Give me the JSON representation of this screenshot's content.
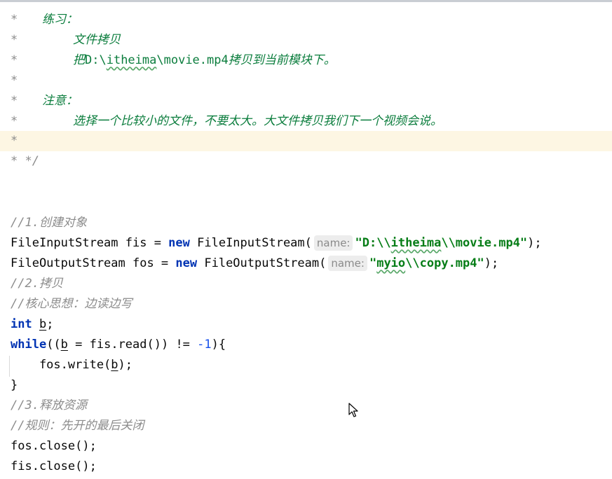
{
  "code": {
    "c1_star": "*",
    "c1_text": "练习：",
    "c2_star": "*",
    "c2_text": "文件拷贝",
    "c3_star": "*",
    "c3_a": "把",
    "c3_b": "D:\\",
    "c3_c": "itheima",
    "c3_d": "\\movie.mp4",
    "c3_e": "拷贝到当前模块下。",
    "c4_star": "*",
    "c5_star": "*",
    "c5_text": "注意：",
    "c6_star": "*",
    "c6_text": "选择一个比较小的文件，不要太大。大文件拷贝我们下一个视频会说。",
    "c7_star": "*",
    "c8_end": "* */",
    "s1_comment": "//1.创建对象",
    "s2_type": "FileInputStream fis = ",
    "s2_new": "new",
    "s2_ctor": " FileInputStream(",
    "s2_hint": "name:",
    "s2_str_a": "\"D:\\\\",
    "s2_str_b": "itheima",
    "s2_str_c": "\\\\movie.mp4\"",
    "s2_end": ");",
    "s3_type": "FileOutputStream fos = ",
    "s3_new": "new",
    "s3_ctor": " FileOutputStream(",
    "s3_hint": "name:",
    "s3_str_a": "\"",
    "s3_str_b": "myio",
    "s3_str_c": "\\\\copy.mp4\"",
    "s3_end": ");",
    "s4_comment": "//2.拷贝",
    "s5_comment": "//核心思想：边读边写",
    "s6_kw": "int",
    "s6_var": "b",
    "s6_end": ";",
    "s7_kw": "while",
    "s7_a": "((",
    "s7_var": "b",
    "s7_b": " = fis.read()) != ",
    "s7_num": "-1",
    "s7_c": "){",
    "s8_a": "    fos.write(",
    "s8_var": "b",
    "s8_b": ");",
    "s9": "}",
    "s10_comment": "//3.释放资源",
    "s11_comment": "//规则：先开的最后关闭",
    "s12": "fos.close();",
    "s13": "fis.close();"
  }
}
